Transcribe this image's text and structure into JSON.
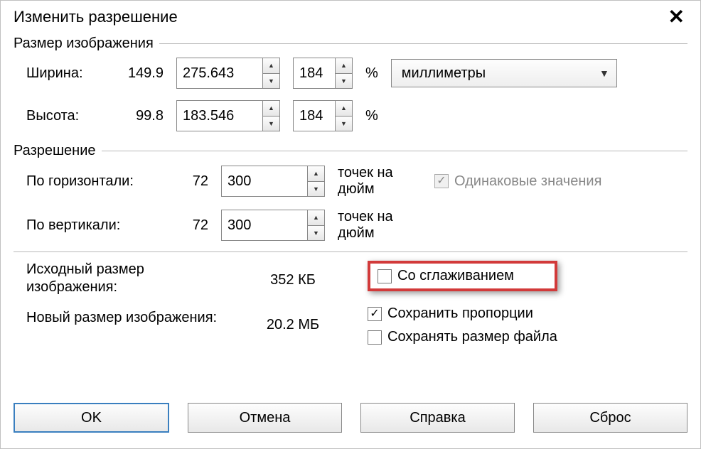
{
  "title": "Изменить разрешение",
  "group_size": {
    "legend": "Размер изображения",
    "width_label": "Ширина:",
    "width_orig": "149.9",
    "width_val": "275.643",
    "width_pct": "184",
    "height_label": "Высота:",
    "height_orig": "99.8",
    "height_val": "183.546",
    "height_pct": "184",
    "pct_sign": "%",
    "unit_combo": "миллиметры"
  },
  "group_res": {
    "legend": "Разрешение",
    "horiz_label": "По горизонтали:",
    "horiz_orig": "72",
    "horiz_val": "300",
    "vert_label": "По вертикали:",
    "vert_orig": "72",
    "vert_val": "300",
    "unit_text": "точек на дюйм",
    "same_label": "Одинаковые значения"
  },
  "info": {
    "orig_size_label": "Исходный размер изображения:",
    "orig_size_val": "352 КБ",
    "new_size_label": "Новый размер изображения:",
    "new_size_val": "20.2 МБ"
  },
  "checks": {
    "antialias": "Со сглаживанием",
    "keep_ratio": "Сохранить пропорции",
    "keep_filesize": "Сохранять размер файла"
  },
  "buttons": {
    "ok": "OK",
    "cancel": "Отмена",
    "help": "Справка",
    "reset": "Сброс"
  },
  "glyph": {
    "check": "✓"
  }
}
